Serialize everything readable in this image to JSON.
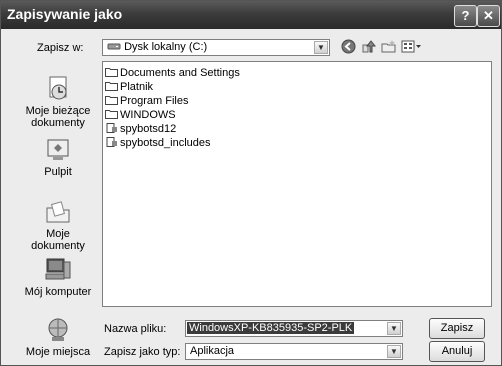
{
  "window": {
    "title": "Zapisywanie jako"
  },
  "title_buttons": {
    "help": "?",
    "close": "✕"
  },
  "save_in": {
    "label": "Zapisz w:",
    "value": "Dysk lokalny (C:)"
  },
  "toolbar": [
    "back-icon",
    "up-folder-icon",
    "new-folder-icon",
    "views-icon"
  ],
  "places": [
    {
      "label": "Moje bieżące dokumenty",
      "icon": "recent-documents-icon"
    },
    {
      "label": "Pulpit",
      "icon": "desktop-icon"
    },
    {
      "label": "Moje dokumenty",
      "icon": "my-documents-icon"
    },
    {
      "label": "Mój komputer",
      "icon": "my-computer-icon"
    },
    {
      "label": "Moje miejsca",
      "icon": "network-places-icon"
    }
  ],
  "files": [
    {
      "name": "Documents and Settings",
      "icon": "folder-icon"
    },
    {
      "name": "Platnik",
      "icon": "folder-icon"
    },
    {
      "name": "Program Files",
      "icon": "folder-icon"
    },
    {
      "name": "WINDOWS",
      "icon": "folder-icon"
    },
    {
      "name": "spybotsd12",
      "icon": "file-icon"
    },
    {
      "name": "spybotsd_includes",
      "icon": "file-icon"
    }
  ],
  "filename": {
    "label": "Nazwa pliku:",
    "value": "WindowsXP-KB835935-SP2-PLK"
  },
  "filetype": {
    "label": "Zapisz jako typ:",
    "value": "Aplikacja"
  },
  "buttons": {
    "save": "Zapisz",
    "cancel": "Anuluj"
  }
}
